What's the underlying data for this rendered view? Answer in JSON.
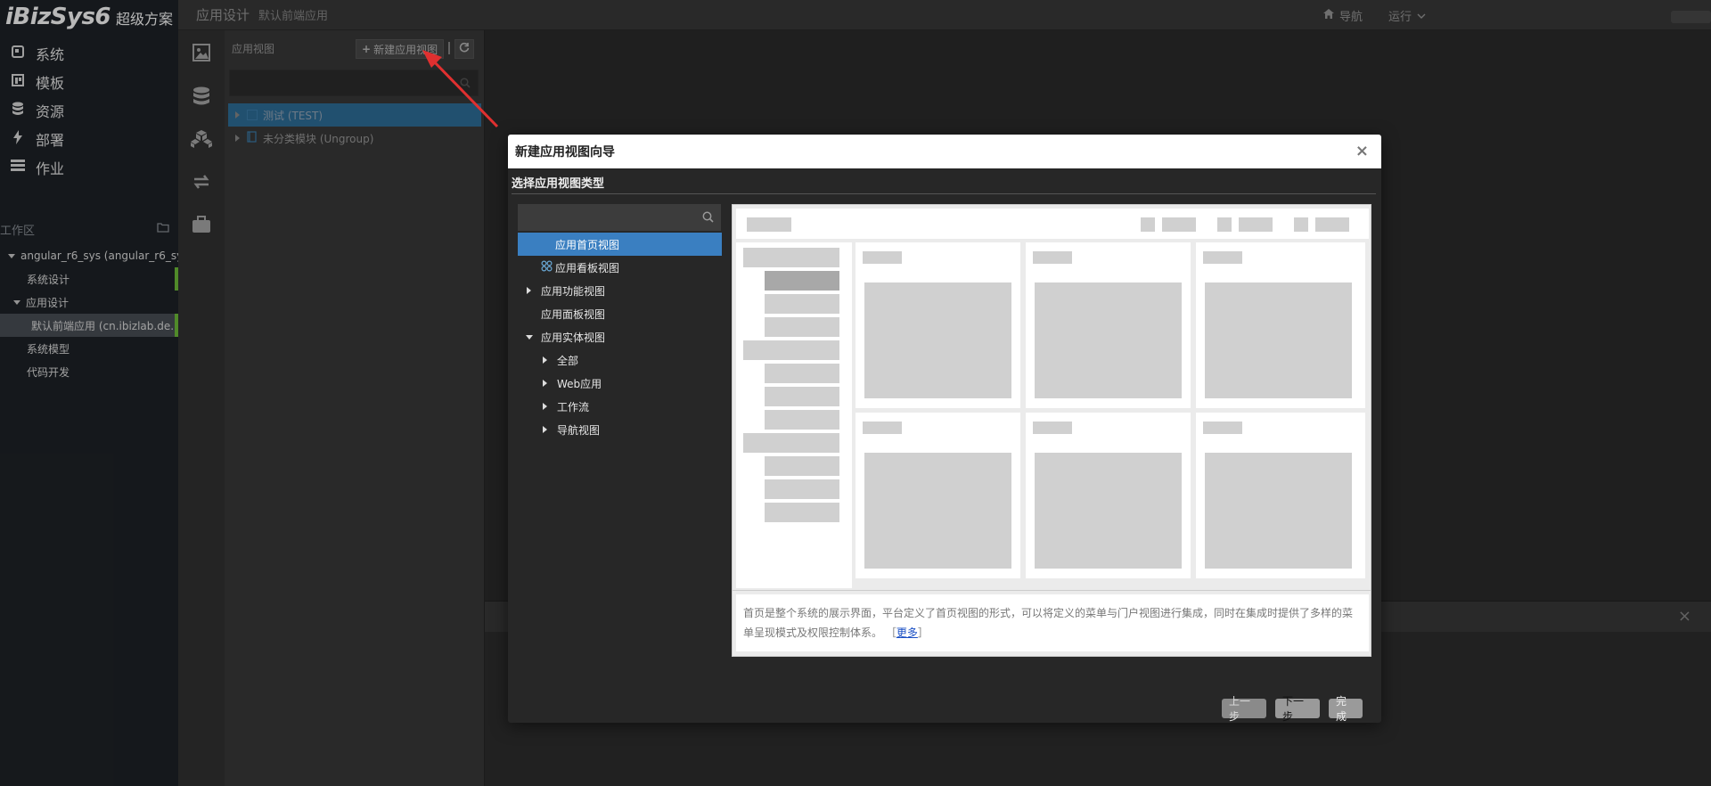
{
  "logo": {
    "brand": "iBizSys6",
    "subtitle": "超级方案"
  },
  "nav": [
    {
      "icon": "system-icon",
      "label": "系统"
    },
    {
      "icon": "template-icon",
      "label": "模板"
    },
    {
      "icon": "database-icon",
      "label": "资源"
    },
    {
      "icon": "bolt-icon",
      "label": "部署"
    },
    {
      "icon": "server-icon",
      "label": "作业"
    }
  ],
  "workspace": {
    "label": "工作区",
    "items": [
      {
        "label": "angular_r6_sys (angular_r6_sys)",
        "level": 0,
        "expanded": true
      },
      {
        "label": "系统设计",
        "level": 1,
        "marked": true
      },
      {
        "label": "应用设计",
        "level": 1,
        "expanded": true
      },
      {
        "label": "默认前端应用 (cn.ibizlab.de...",
        "level": 2,
        "selected": true,
        "marked": true
      },
      {
        "label": "系统模型",
        "level": 1
      },
      {
        "label": "代码开发",
        "level": 1
      }
    ]
  },
  "topbar": {
    "title": "应用设计",
    "subtitle": "默认前端应用",
    "nav_label": "导航",
    "run_label": "运行"
  },
  "view_panel": {
    "title": "应用视图",
    "new_button": "新建应用视图",
    "rows": [
      {
        "label": "测试 (TEST)",
        "selected": true
      },
      {
        "label": "未分类模块 (Ungroup)",
        "selected": false
      }
    ]
  },
  "dialog": {
    "title": "新建应用视图向导",
    "subtitle": "选择应用视图类型",
    "types": [
      {
        "label": "应用首页视图",
        "level": 0,
        "selected": true,
        "caret": "none"
      },
      {
        "label": "应用看板视图",
        "level": 0,
        "caret": "none",
        "icon": "kanban-icon"
      },
      {
        "label": "应用功能视图",
        "level": 0,
        "caret": "right"
      },
      {
        "label": "应用面板视图",
        "level": 0,
        "caret": "none"
      },
      {
        "label": "应用实体视图",
        "level": 0,
        "caret": "down"
      },
      {
        "label": "全部",
        "level": 1,
        "caret": "right"
      },
      {
        "label": "Web应用",
        "level": 1,
        "caret": "right"
      },
      {
        "label": "工作流",
        "level": 1,
        "caret": "right"
      },
      {
        "label": "导航视图",
        "level": 1,
        "caret": "right"
      }
    ],
    "description": "首页是整个系统的展示界面，平台定义了首页视图的形式，可以将定义的菜单与门户视图进行集成，同时在集成时提供了多样的菜单呈现模式及权限控制体系。",
    "more_open": "［",
    "more_label": "更多",
    "more_close": "］",
    "buttons": {
      "prev": "上一步",
      "next": "下一步",
      "finish": "完成"
    }
  },
  "colors": {
    "nav_bg": "#1e2227",
    "selected_blue": "#3a7fc1",
    "marker_green": "#6fbf3a",
    "arrow_red": "#e03030"
  }
}
